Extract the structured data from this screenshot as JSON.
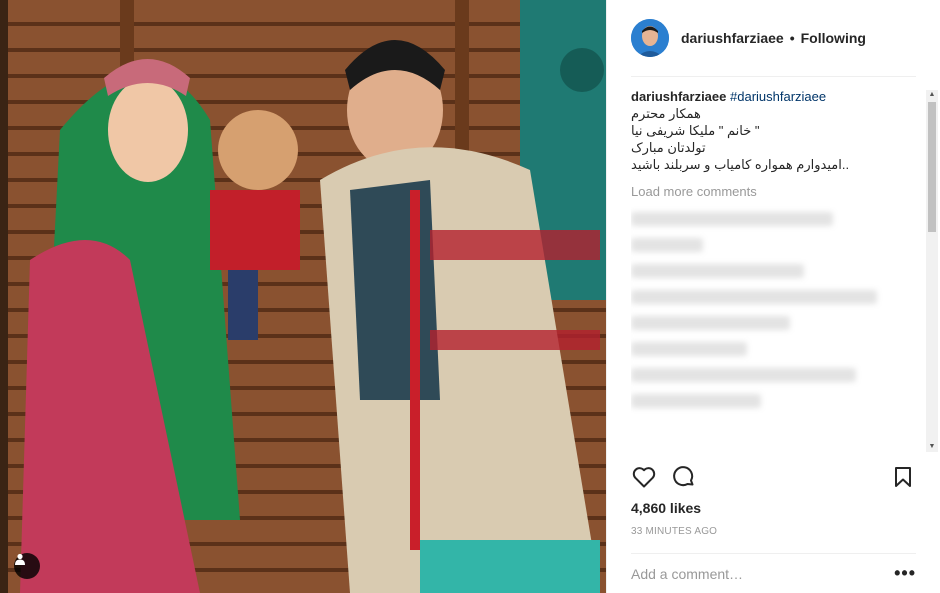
{
  "post": {
    "username": "dariushfarziaee",
    "follow_state": "Following",
    "separator": "•"
  },
  "caption": {
    "username": "dariushfarziaee",
    "hashtag": "#dariushfarziaee",
    "text": "همکار محترم\n\" خانم \" ملیکا شریفی نیا\nتولدتان مبارک\n..امیدوارم همواره کامیاب و سربلند باشید"
  },
  "comments": {
    "load_more_label": "Load more comments"
  },
  "actions": {
    "like_icon": "heart-icon",
    "comment_icon": "comment-bubble-icon",
    "save_icon": "bookmark-icon"
  },
  "likes_text": "4,860 likes",
  "timestamp": "33 MINUTES AGO",
  "comment_box": {
    "placeholder": "Add a comment…",
    "more_label": "•••"
  },
  "colors": {
    "hashtag": "#003569",
    "muted": "#999999",
    "border": "#efefef"
  }
}
